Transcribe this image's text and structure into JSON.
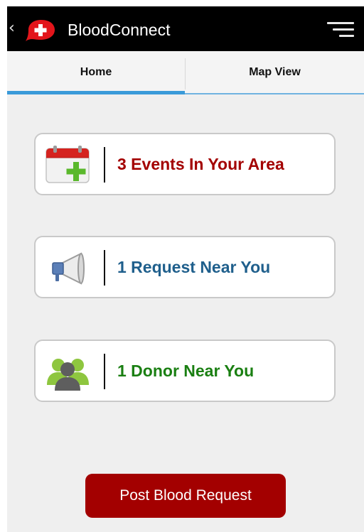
{
  "action_bar": {
    "title": "BloodConnect",
    "back_icon": "chevron-left-icon",
    "logo_icon": "blood-drop-cross-logo",
    "menu_icon": "overflow-menu-icon",
    "background": "#000000"
  },
  "tabs": [
    {
      "label": "Home",
      "selected": true
    },
    {
      "label": "Map View",
      "selected": false
    }
  ],
  "cards": {
    "events": {
      "label": "3 Events In Your Area",
      "icon": "calendar-add-icon",
      "color": "#a30000"
    },
    "requests": {
      "label": "1 Request Near You",
      "icon": "megaphone-icon",
      "color": "#1f5f8c"
    },
    "donors": {
      "label": "1 Donor Near You",
      "icon": "people-icon",
      "color": "#1a7f12"
    }
  },
  "post_button": {
    "label": "Post Blood Request",
    "color": "#a30000"
  },
  "colors": {
    "tab_indicator": "#3a9ad9",
    "content_background": "#efefef"
  }
}
